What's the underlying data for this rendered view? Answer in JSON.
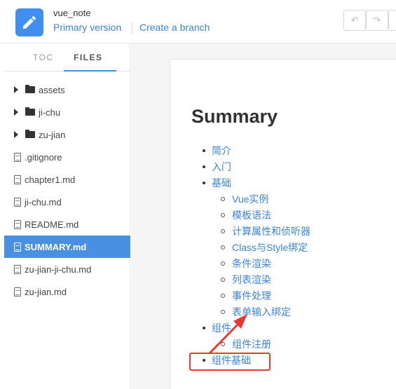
{
  "header": {
    "book_title": "vue_note",
    "primary_version": "Primary version",
    "create_branch": "Create a branch"
  },
  "sidebar": {
    "tabs": [
      "TOC",
      "FILES"
    ],
    "items": [
      {
        "label": "assets",
        "type": "folder"
      },
      {
        "label": "ji-chu",
        "type": "folder"
      },
      {
        "label": "zu-jian",
        "type": "folder"
      },
      {
        "label": ".gitignore",
        "type": "file"
      },
      {
        "label": "chapter1.md",
        "type": "file"
      },
      {
        "label": "ji-chu.md",
        "type": "file"
      },
      {
        "label": "README.md",
        "type": "file"
      },
      {
        "label": "SUMMARY.md",
        "type": "file",
        "selected": true
      },
      {
        "label": "zu-jian-ji-chu.md",
        "type": "file"
      },
      {
        "label": "zu-jian.md",
        "type": "file"
      }
    ]
  },
  "main": {
    "title": "Summary",
    "toc": [
      {
        "label": "简介",
        "level": 1
      },
      {
        "label": "入门",
        "level": 1
      },
      {
        "label": "基础",
        "level": 1
      },
      {
        "label": "Vue实例",
        "level": 2
      },
      {
        "label": "模板语法",
        "level": 2
      },
      {
        "label": "计算属性和侦听器",
        "level": 2
      },
      {
        "label": "Class与Style绑定",
        "level": 2
      },
      {
        "label": "条件渲染",
        "level": 2
      },
      {
        "label": "列表渲染",
        "level": 2
      },
      {
        "label": "事件处理",
        "level": 2
      },
      {
        "label": "表单输入绑定",
        "level": 2
      },
      {
        "label": "组件",
        "level": 1
      },
      {
        "label": "组件注册",
        "level": 2
      },
      {
        "label": "组件基础",
        "level": 1
      }
    ]
  },
  "colors": {
    "accent": "#3f8ef0",
    "link": "#3c84d8",
    "selected_bg": "#4a90e2",
    "annotation": "#e53935"
  }
}
